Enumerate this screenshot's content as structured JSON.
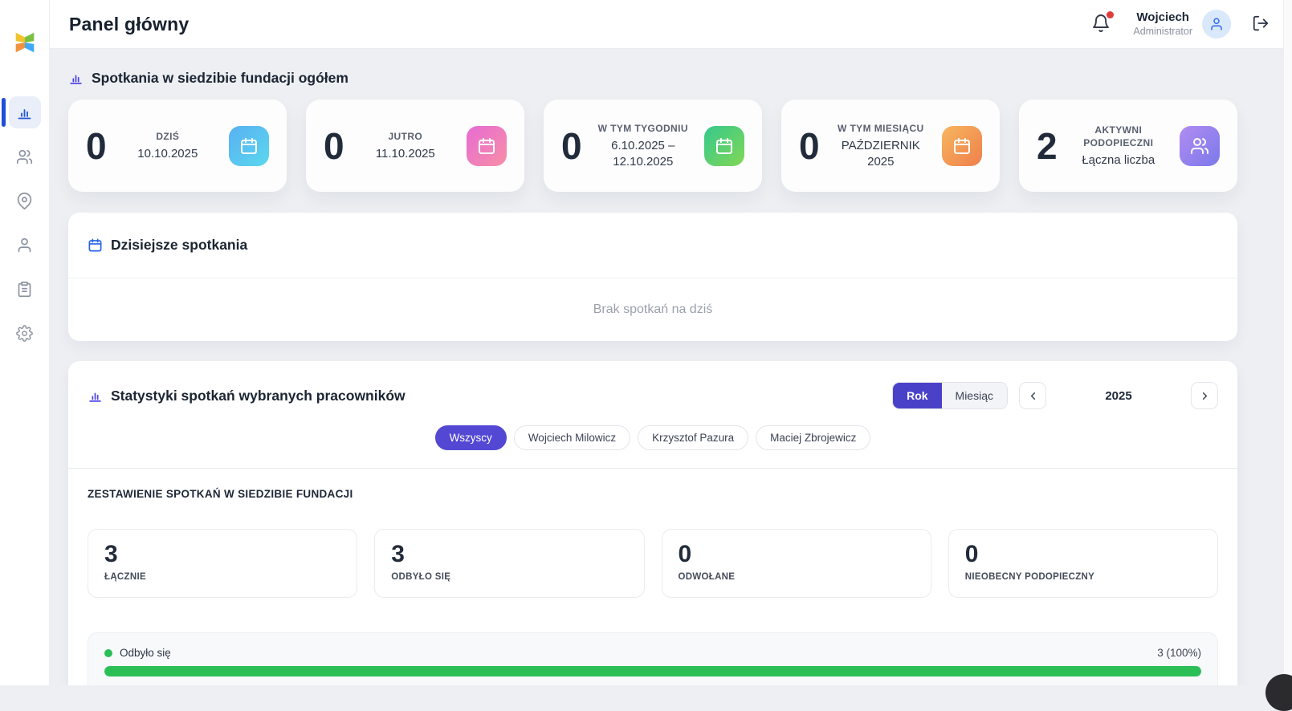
{
  "header": {
    "title": "Panel główny",
    "user": {
      "name": "Wojciech",
      "role": "Administrator"
    },
    "icons": [
      "bell-icon",
      "avatar-user-icon",
      "logout-icon"
    ],
    "notification_dot_color": "#e23b3b"
  },
  "sidebar": {
    "logo_icon": "butterfly-logo",
    "items": [
      {
        "icon": "bar-chart-icon",
        "name": "dashboard",
        "active": true
      },
      {
        "icon": "users-icon",
        "name": "users",
        "active": false
      },
      {
        "icon": "map-pin-icon",
        "name": "locations",
        "active": false
      },
      {
        "icon": "user-icon",
        "name": "profile",
        "active": false
      },
      {
        "icon": "clipboard-icon",
        "name": "reports",
        "active": false
      },
      {
        "icon": "gear-icon",
        "name": "settings",
        "active": false
      }
    ],
    "active_color": "#1d4ed8"
  },
  "sections": {
    "meetings_overview": {
      "title": "Spotkania w siedzibie fundacji ogółem",
      "icon": "bar-chart-icon",
      "cards": [
        {
          "value": "0",
          "label": "DZIŚ",
          "sublabel": "10.10.2025",
          "icon": "calendar-icon",
          "gradient": [
            "#59b0f2",
            "#5ad8ee"
          ]
        },
        {
          "value": "0",
          "label": "JUTRO",
          "sublabel": "11.10.2025",
          "icon": "calendar-icon",
          "gradient": [
            "#e76bd2",
            "#f78fa7"
          ]
        },
        {
          "value": "0",
          "label": "W TYM TYGODNIU",
          "sublabel": "6.10.2025 – 12.10.2025",
          "icon": "calendar-icon",
          "gradient": [
            "#34c98c",
            "#82d755"
          ]
        },
        {
          "value": "0",
          "label": "W TYM MIESIĄCU",
          "sublabel": "PAŹDZIERNIK 2025",
          "icon": "calendar-icon",
          "gradient": [
            "#f7b65f",
            "#ee7f4b"
          ]
        },
        {
          "value": "2",
          "label": "AKTYWNI PODOPIECZNI",
          "sublabel": "Łączna liczba",
          "icon": "users-icon",
          "gradient": [
            "#b18cf2",
            "#7b79ea"
          ]
        }
      ]
    },
    "today_meetings": {
      "title": "Dzisiejsze spotkania",
      "icon": "calendar-icon",
      "empty_text": "Brak spotkań na dziś"
    },
    "stats": {
      "title": "Statystyki spotkań wybranych pracowników",
      "icon": "bar-chart-icon",
      "period_toggle": {
        "options": [
          "Rok",
          "Miesiąc"
        ],
        "selected": "Rok",
        "selected_color": "#4a41c9"
      },
      "year": "2025",
      "filters": [
        {
          "label": "Wszyscy",
          "active": true
        },
        {
          "label": "Wojciech Milowicz",
          "active": false
        },
        {
          "label": "Krzysztof Pazura",
          "active": false
        },
        {
          "label": "Maciej Zbrojewicz",
          "active": false
        }
      ],
      "summary_title": "ZESTAWIENIE SPOTKAŃ W SIEDZIBIE FUNDACJI",
      "summary_cards": [
        {
          "value": "3",
          "label": "ŁĄCZNIE"
        },
        {
          "value": "3",
          "label": "ODBYŁO SIĘ"
        },
        {
          "value": "0",
          "label": "ODWOŁANE"
        },
        {
          "value": "0",
          "label": "NIEOBECNY PODOPIECZNY"
        }
      ],
      "progress": {
        "label": "Odbyło się",
        "value": "3 (100%)",
        "percent": 100,
        "color": "#2cbe57"
      }
    }
  }
}
